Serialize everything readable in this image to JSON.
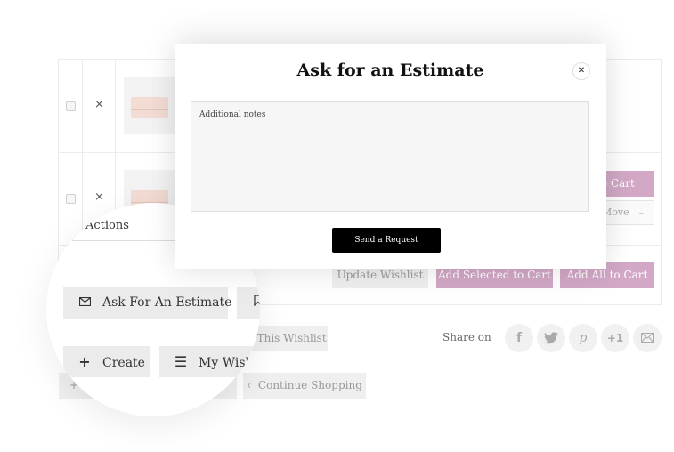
{
  "modal": {
    "title": "Ask for an Estimate",
    "close_icon": "close-icon",
    "notes_placeholder": "Additional notes",
    "notes_value": "",
    "send_label": "Send a Request"
  },
  "table": {
    "rows": [
      {
        "remove_icon": "×",
        "checked": false
      },
      {
        "remove_icon": "×",
        "checked": false
      }
    ],
    "add_to_cart_label": "Add to Cart",
    "move_select_value": "Move",
    "actions_select_value": "Actions"
  },
  "footer_buttons": {
    "update_wishlist": "Update Wishlist",
    "add_selected": "Add Selected to Cart",
    "add_all": "Add All to Cart",
    "show_wishlist": "Show This Wishlist",
    "continue_shopping": "Continue Shopping",
    "continue_icon": "‹"
  },
  "magnified": {
    "ask_estimate": "Ask For An Estimate",
    "create": "Create",
    "my_wishlists": "My Wishlists"
  },
  "share": {
    "label": "Share on",
    "networks": [
      {
        "name": "facebook",
        "glyph": "f"
      },
      {
        "name": "twitter",
        "glyph": "t"
      },
      {
        "name": "pinterest",
        "glyph": "p"
      },
      {
        "name": "google-plus",
        "glyph": "+1"
      },
      {
        "name": "email",
        "glyph": "✉"
      }
    ]
  },
  "colors": {
    "accent_pink": "#d2a8c6",
    "send_button": "#000000"
  }
}
